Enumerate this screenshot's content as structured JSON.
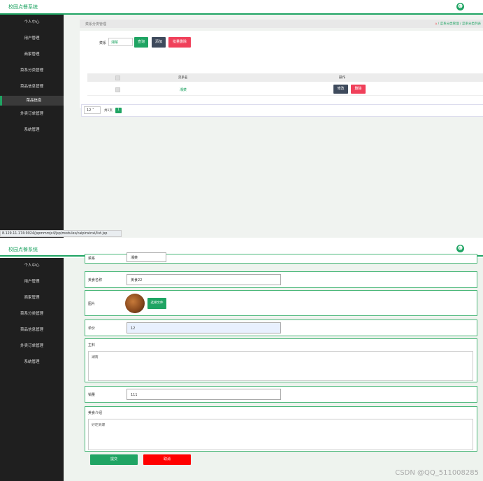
{
  "app": {
    "title": "校园点餐系统"
  },
  "sidebar": {
    "items": [
      "个人中心",
      "用户管理",
      "商家管理",
      "菜系分类管理",
      "菜品信息管理",
      "菜品信息",
      "外卖订单管理",
      "系统管理"
    ]
  },
  "sidebar2": {
    "items": [
      "个人中心",
      "用户管理",
      "商家管理",
      "菜系分类管理",
      "菜品信息管理",
      "外卖订单管理",
      "系统管理"
    ]
  },
  "list_page": {
    "breadcrumb_title": "菜系分类管理",
    "breadcrumb_path": "/ 菜系分类管理 / 菜系分类列表",
    "search_label": "菜系",
    "search_value": "湘菜",
    "buttons": {
      "query": "查询",
      "add": "添加",
      "batch_delete": "批量删除"
    },
    "table": {
      "headers": [
        "菜系名",
        "操作"
      ],
      "rows": [
        {
          "name": "湘菜",
          "modify": "修改",
          "delete": "删除"
        }
      ]
    },
    "pager": {
      "page_size": "12",
      "total": "共1页",
      "current": "1"
    }
  },
  "status_url": "8.129.11.174:9024/jspmmmjc4/jsp/modules/caipinxinxi/list.jsp",
  "form": {
    "label_cuisine": "菜系",
    "value_cuisine": "湘菜",
    "label_name": "美食名称",
    "value_name": "美食22",
    "label_image": "图片",
    "upload_button": "选择文件",
    "label_price": "单价",
    "value_price": "12",
    "label_ingredients": "主料",
    "value_ingredients": "湖南",
    "label_sales": "销量",
    "value_sales": "111",
    "label_intro": "美食介绍",
    "value_intro": "好吃到爆",
    "submit": "提交",
    "cancel": "取消"
  },
  "watermark": "CSDN @QQ_511008285",
  "colors": {
    "primary": "#1fa463",
    "danger": "#f0405a",
    "dark": "#3e4a5c",
    "sidebar": "#1f1f1f"
  }
}
